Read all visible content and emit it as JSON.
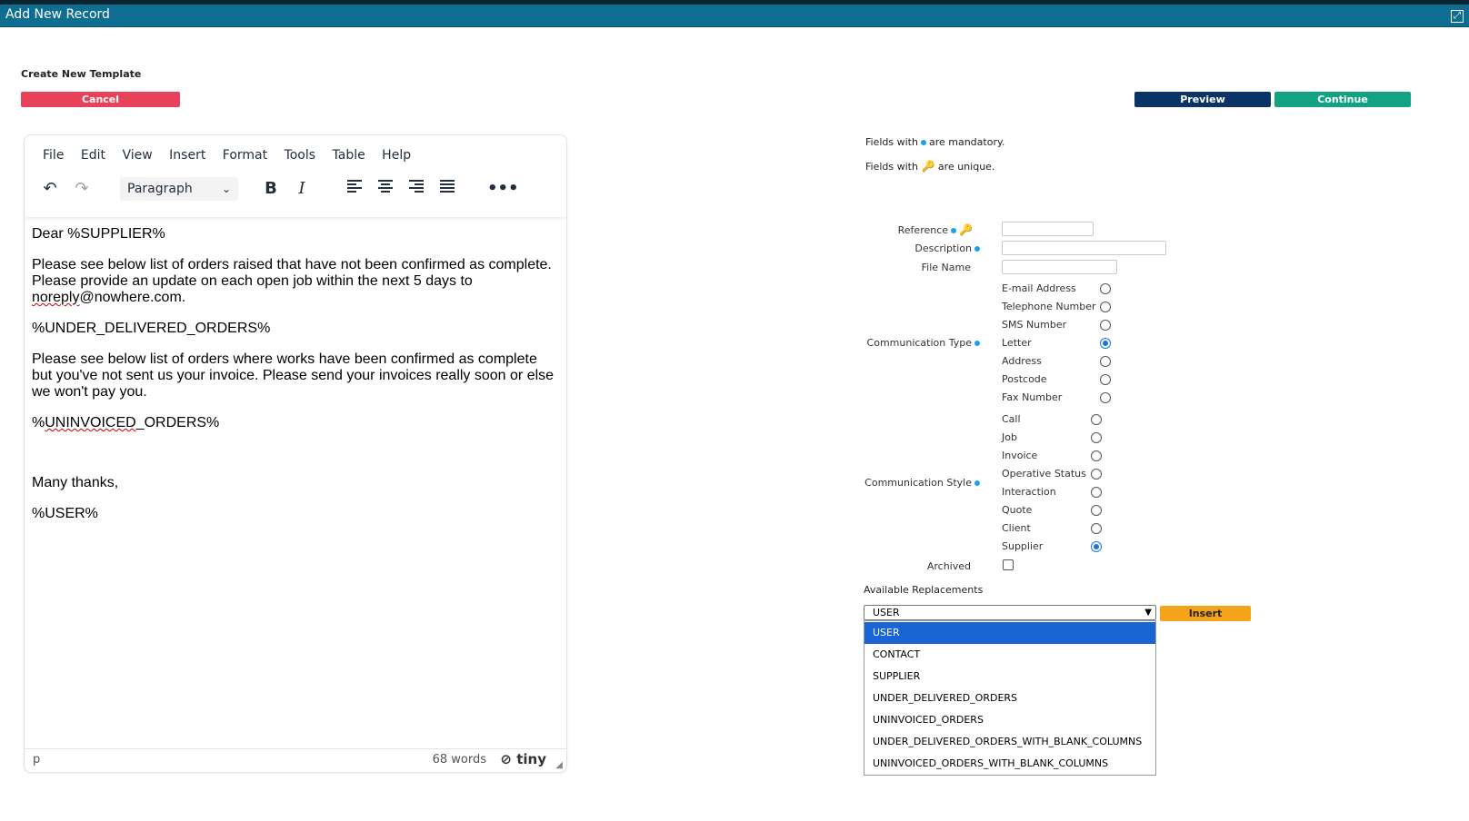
{
  "window": {
    "title": "Add New Record"
  },
  "page": {
    "heading": "Create New Template",
    "cancel_label": "Cancel",
    "preview_label": "Preview",
    "continue_label": "Continue"
  },
  "editor": {
    "menu": [
      "File",
      "Edit",
      "View",
      "Insert",
      "Format",
      "Tools",
      "Table",
      "Help"
    ],
    "block_format": "Paragraph",
    "content": {
      "p1": "Dear %SUPPLIER%",
      "p2_line1": "Please see below list of  orders raised that have not been confirmed as complete.",
      "p2_line2": "Please provide an update on each open job within the next 5  days to",
      "p2_email": "noreply",
      "p2_email_rest": "@nowhere.com.",
      "p3": "%UNDER_DELIVERED_ORDERS%",
      "p4_line1": "Please see below list of  orders where works have been confirmed as complete",
      "p4_line2": "but you've not sent us your invoice. Please send your invoices really soon or else",
      "p4_line3": "we won't pay you.",
      "p5_pre": "%",
      "p5_spell": "UNINVOICED",
      "p5_post": "_ORDERS%",
      "p6": "Many thanks,",
      "p7": "%USER%"
    },
    "status": {
      "path": "p",
      "word_count": "68 words",
      "brand": "tiny"
    }
  },
  "form": {
    "mandatory_note_pre": "Fields with",
    "mandatory_note_post": "are mandatory.",
    "unique_note_pre": "Fields with",
    "unique_note_post": "are unique.",
    "reference_label": "Reference",
    "description_label": "Description",
    "filename_label": "File Name",
    "comm_type_label": "Communication Type",
    "comm_type_options": [
      "E-mail Address",
      "Telephone Number",
      "SMS Number",
      "Letter",
      "Address",
      "Postcode",
      "Fax Number"
    ],
    "comm_type_selected": "Letter",
    "comm_style_label": "Communication Style",
    "comm_style_options": [
      "Call",
      "Job",
      "Invoice",
      "Operative Status",
      "Interaction",
      "Quote",
      "Client",
      "Supplier"
    ],
    "comm_style_selected": "Supplier",
    "archived_label": "Archived",
    "replacements_label": "Available Replacements",
    "replacement_selected": "USER",
    "insert_label": "Insert",
    "replacement_options": [
      "USER",
      "CONTACT",
      "SUPPLIER",
      "UNDER_DELIVERED_ORDERS",
      "UNINVOICED_ORDERS",
      "UNDER_DELIVERED_ORDERS_WITH_BLANK_COLUMNS",
      "UNINVOICED_ORDERS_WITH_BLANK_COLUMNS"
    ]
  }
}
